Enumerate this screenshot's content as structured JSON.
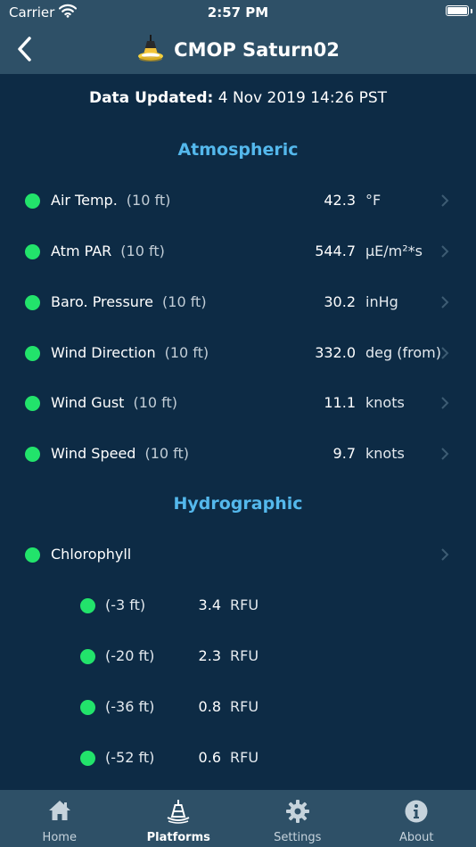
{
  "status_bar": {
    "carrier": "Carrier",
    "time": "2:57 PM"
  },
  "nav": {
    "title": "CMOP Saturn02"
  },
  "updated": {
    "label": "Data Updated:",
    "value": "4 Nov 2019 14:26 PST"
  },
  "sections": [
    {
      "title": "Atmospheric",
      "rows": [
        {
          "name": "Air Temp.",
          "depth": "(10 ft)",
          "value": "42.3",
          "unit": "°F"
        },
        {
          "name": "Atm PAR",
          "depth": "(10 ft)",
          "value": "544.7",
          "unit": "µE/m²*s"
        },
        {
          "name": "Baro. Pressure",
          "depth": "(10 ft)",
          "value": "30.2",
          "unit": "inHg"
        },
        {
          "name": "Wind Direction",
          "depth": "(10 ft)",
          "value": "332.0",
          "unit": "deg (from)"
        },
        {
          "name": "Wind Gust",
          "depth": "(10 ft)",
          "value": "11.1",
          "unit": "knots"
        },
        {
          "name": "Wind Speed",
          "depth": "(10 ft)",
          "value": "9.7",
          "unit": "knots"
        }
      ]
    },
    {
      "title": "Hydrographic",
      "rows": [
        {
          "name": "Chlorophyll",
          "subrows": [
            {
              "depth": "(-3 ft)",
              "value": "3.4",
              "unit": "RFU"
            },
            {
              "depth": "(-20 ft)",
              "value": "2.3",
              "unit": "RFU"
            },
            {
              "depth": "(-36 ft)",
              "value": "0.8",
              "unit": "RFU"
            },
            {
              "depth": "(-52 ft)",
              "value": "0.6",
              "unit": "RFU"
            }
          ]
        }
      ]
    }
  ],
  "tabs": [
    {
      "label": "Home",
      "icon": "home-icon"
    },
    {
      "label": "Platforms",
      "icon": "buoy-icon",
      "active": true
    },
    {
      "label": "Settings",
      "icon": "gear-icon"
    },
    {
      "label": "About",
      "icon": "info-icon"
    }
  ],
  "colors": {
    "background": "#0d2b45",
    "bar": "#2e5067",
    "section_header": "#54b8ec",
    "status_ok": "#22e36b"
  }
}
